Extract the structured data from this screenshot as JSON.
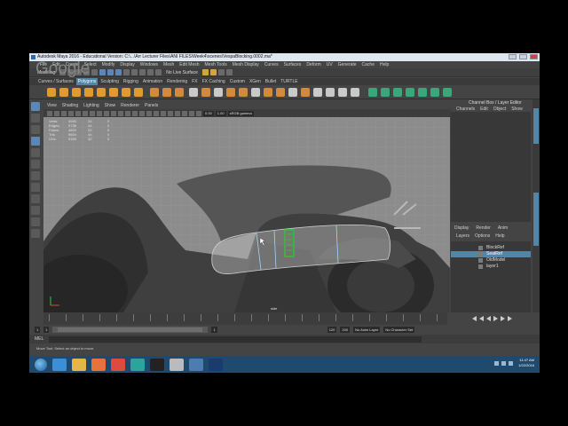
{
  "overlay": {
    "logo_text": "Google"
  },
  "window": {
    "title": "Autodesk Maya 2016 - Educational Version: C:\\...\\Arr Lecturer Files\\ANI FILES\\Week4\\scenes\\VespaBlocking.0002.ma*"
  },
  "menubar": {
    "items": [
      "File",
      "Edit",
      "Create",
      "Select",
      "Modify",
      "Display",
      "Windows",
      "Mesh",
      "Edit Mesh",
      "Mesh Tools",
      "Mesh Display",
      "Curves",
      "Surfaces",
      "Deform",
      "UV",
      "Generate",
      "Cache",
      "Help"
    ]
  },
  "statusline": {
    "mode_label": "Modeling",
    "live_surface": "No Live Surface"
  },
  "shelf": {
    "tabs": [
      "Curves / Surfaces",
      "Polygons",
      "Sculpting",
      "Rigging",
      "Animation",
      "Rendering",
      "FX",
      "FX Caching",
      "Custom",
      "XGen",
      "Bullet",
      "TURTLE"
    ],
    "active_tab": "Polygons"
  },
  "viewport": {
    "menu": [
      "View",
      "Shading",
      "Lighting",
      "Show",
      "Renderer",
      "Panels"
    ],
    "toolbar_fields": {
      "near": "0.00",
      "far": "1.00",
      "color_space": "sRGB gamma"
    },
    "hud": {
      "rows": [
        {
          "label": "Verts:",
          "v1": "4940",
          "v2": "24",
          "v3": "0"
        },
        {
          "label": "Edges:",
          "v1": "9738",
          "v2": "44",
          "v3": "0"
        },
        {
          "label": "Faces:",
          "v1": "4820",
          "v2": "22",
          "v3": "0"
        },
        {
          "label": "Tris:",
          "v1": "9604",
          "v2": "44",
          "v3": "0"
        },
        {
          "label": "UVs:",
          "v1": "5159",
          "v2": "42",
          "v3": "0"
        }
      ]
    },
    "camera_label": "side"
  },
  "channel_box": {
    "title": "Channel Box / Layer Editor",
    "tabs": [
      "Channels",
      "Edit",
      "Object",
      "Show"
    ]
  },
  "layer_editor": {
    "tabs": [
      "Display",
      "Render",
      "Anim"
    ],
    "menus": [
      "Layers",
      "Options",
      "Help"
    ],
    "layers": [
      {
        "name": "BlockRef",
        "selected": false
      },
      {
        "name": "SeatRef",
        "selected": true
      },
      {
        "name": "OldModel",
        "selected": false
      },
      {
        "name": "layer1",
        "selected": false
      }
    ]
  },
  "timeline": {
    "start": "1",
    "current": "1",
    "range_start": "1",
    "range_end": "120",
    "end": "120",
    "max_end": "200",
    "anim_layer": "No Anim Layer",
    "char_set": "No Character Set"
  },
  "command_line": {
    "label": "MEL"
  },
  "help_line": {
    "text": "Move Tool: Select an object to move."
  },
  "taskbar": {
    "apps": [
      "start",
      "ie",
      "explorer",
      "media",
      "chrome",
      "maya",
      "cmd",
      "maya2",
      "other",
      "photoshop"
    ],
    "clock_time": "11:47 AM",
    "clock_date": "1/22/2016"
  }
}
